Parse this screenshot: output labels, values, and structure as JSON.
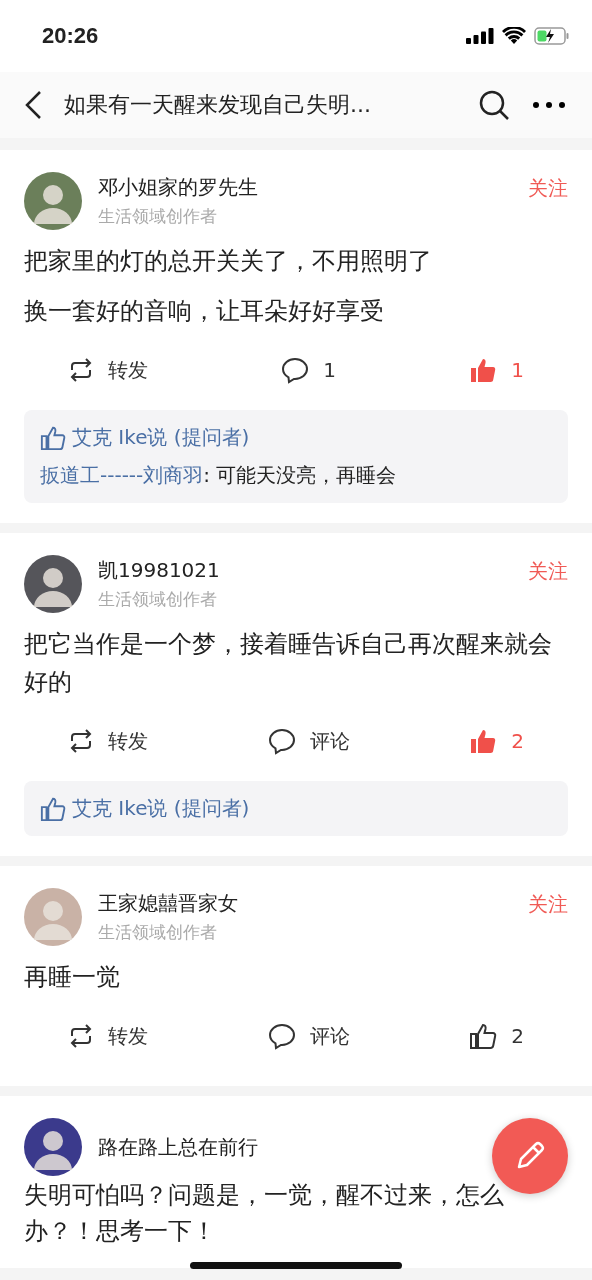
{
  "status_bar": {
    "time": "20:26",
    "charging": true
  },
  "nav": {
    "title": "如果有一天醒来发现自己失明..."
  },
  "answers": [
    {
      "author": "邓小姐家的罗先生",
      "role": "生活领域创作者",
      "follow": "关注",
      "paragraphs": [
        "把家里的灯的总开关关了，不用照明了",
        "换一套好的音响，让耳朵好好享受"
      ],
      "share": "转发",
      "comment": "1",
      "liked": true,
      "likes_label": "1",
      "upvote": "艾克 Ike说 (提问者)",
      "reply": {
        "author": "扳道工------刘商羽",
        "text": ": 可能天没亮，再睡会"
      }
    },
    {
      "author": "凯19981021",
      "role": "生活领域创作者",
      "follow": "关注",
      "paragraphs": [
        "把它当作是一个梦，接着睡告诉自己再次醒来就会好的"
      ],
      "share": "转发",
      "comment": "评论",
      "liked": true,
      "likes_label": "2",
      "upvote": "艾克 Ike说 (提问者)"
    },
    {
      "author": "王家媳囍晋家女",
      "role": "生活领域创作者",
      "follow": "关注",
      "paragraphs": [
        "再睡一觉"
      ],
      "share": "转发",
      "comment": "评论",
      "liked": false,
      "likes_label": "2"
    },
    {
      "author": "路在路上总在前行",
      "paragraphs": [
        "失明可怕吗？问题是，一觉，醒不过来，怎么",
        "办？！思考一下！"
      ]
    }
  ]
}
